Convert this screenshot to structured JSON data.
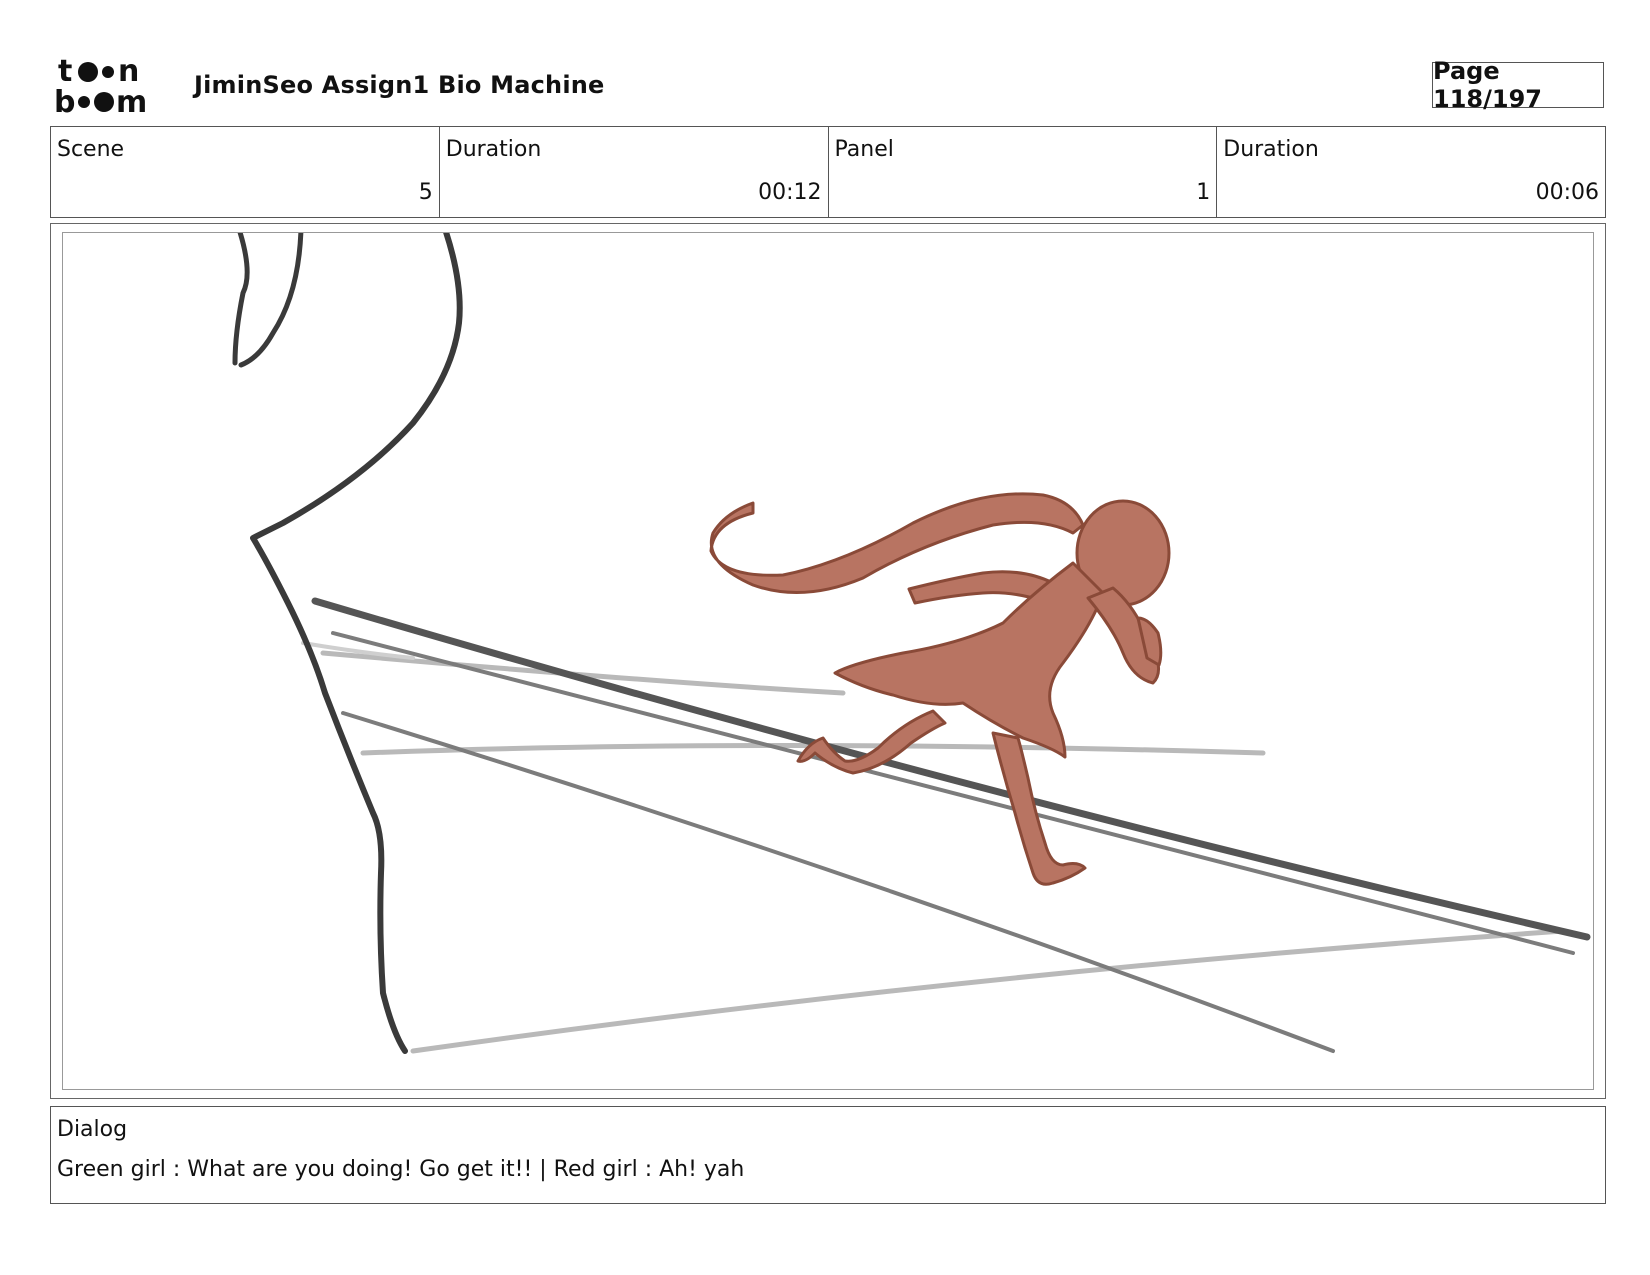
{
  "header": {
    "logo_text": "toon boom",
    "title": "JiminSeo Assign1 Bio Machine",
    "page": "Page 118/197"
  },
  "info": {
    "scene_label": "Scene",
    "scene_value": "5",
    "scene_duration_label": "Duration",
    "scene_duration_value": "00:12",
    "panel_label": "Panel",
    "panel_value": "1",
    "panel_duration_label": "Duration",
    "panel_duration_value": "00:06"
  },
  "dialog": {
    "label": "Dialog",
    "text": "Green girl : What are you doing! Go get it!! | Red girl : Ah! yah"
  },
  "colors": {
    "figure_fill": "#b87462",
    "figure_outline": "#8a4a38",
    "sketch_dark": "#3a3a3a",
    "sketch_light": "#b9b9b9"
  }
}
